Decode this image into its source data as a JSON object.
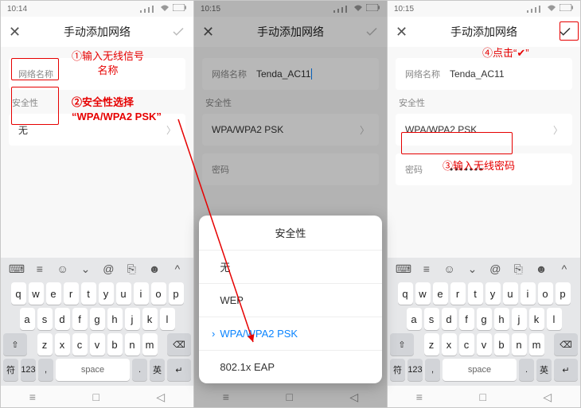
{
  "status": {
    "time1": "10:14",
    "time2": "10:15",
    "time3": "10:15"
  },
  "title": "手动添加网络",
  "labels": {
    "network_name": "网络名称",
    "security": "安全性",
    "password": "密码"
  },
  "phone1": {
    "security_value": "无"
  },
  "phone2": {
    "network_value": "Tenda_AC11",
    "security_value": "WPA/WPA2 PSK"
  },
  "phone3": {
    "network_value": "Tenda_AC11",
    "security_value": "WPA/WPA2 PSK",
    "password_mask": "•••••••"
  },
  "sheet": {
    "title": "安全性",
    "items": [
      "无",
      "WEP",
      "WPA/WPA2 PSK",
      "802.1x EAP"
    ],
    "selected_index": 2
  },
  "keyboard": {
    "util": [
      "⌨",
      "≡",
      "☺",
      "⌄",
      "@",
      "⎘",
      "☻",
      "^"
    ],
    "row1": [
      "q",
      "w",
      "e",
      "r",
      "t",
      "y",
      "u",
      "i",
      "o",
      "p"
    ],
    "row2": [
      "a",
      "s",
      "d",
      "f",
      "g",
      "h",
      "j",
      "k",
      "l"
    ],
    "shift": "⇧",
    "row3": [
      "z",
      "x",
      "c",
      "v",
      "b",
      "n",
      "m"
    ],
    "bksp": "⌫",
    "fn_sym": "符",
    "fn_num": "123",
    "fn_comma": ",",
    "space": "space",
    "fn_dot": ".",
    "fn_lang": "英",
    "enter": "↵"
  },
  "nav": {
    "back": "≡",
    "home": "□",
    "recent": "◁"
  },
  "annotations": {
    "a1": "①输入无线信号\n名称",
    "a2": "②安全性选择\n“WPA/WPA2 PSK”",
    "a3": "③输入无线密码",
    "a4": "④点击“✔”"
  }
}
